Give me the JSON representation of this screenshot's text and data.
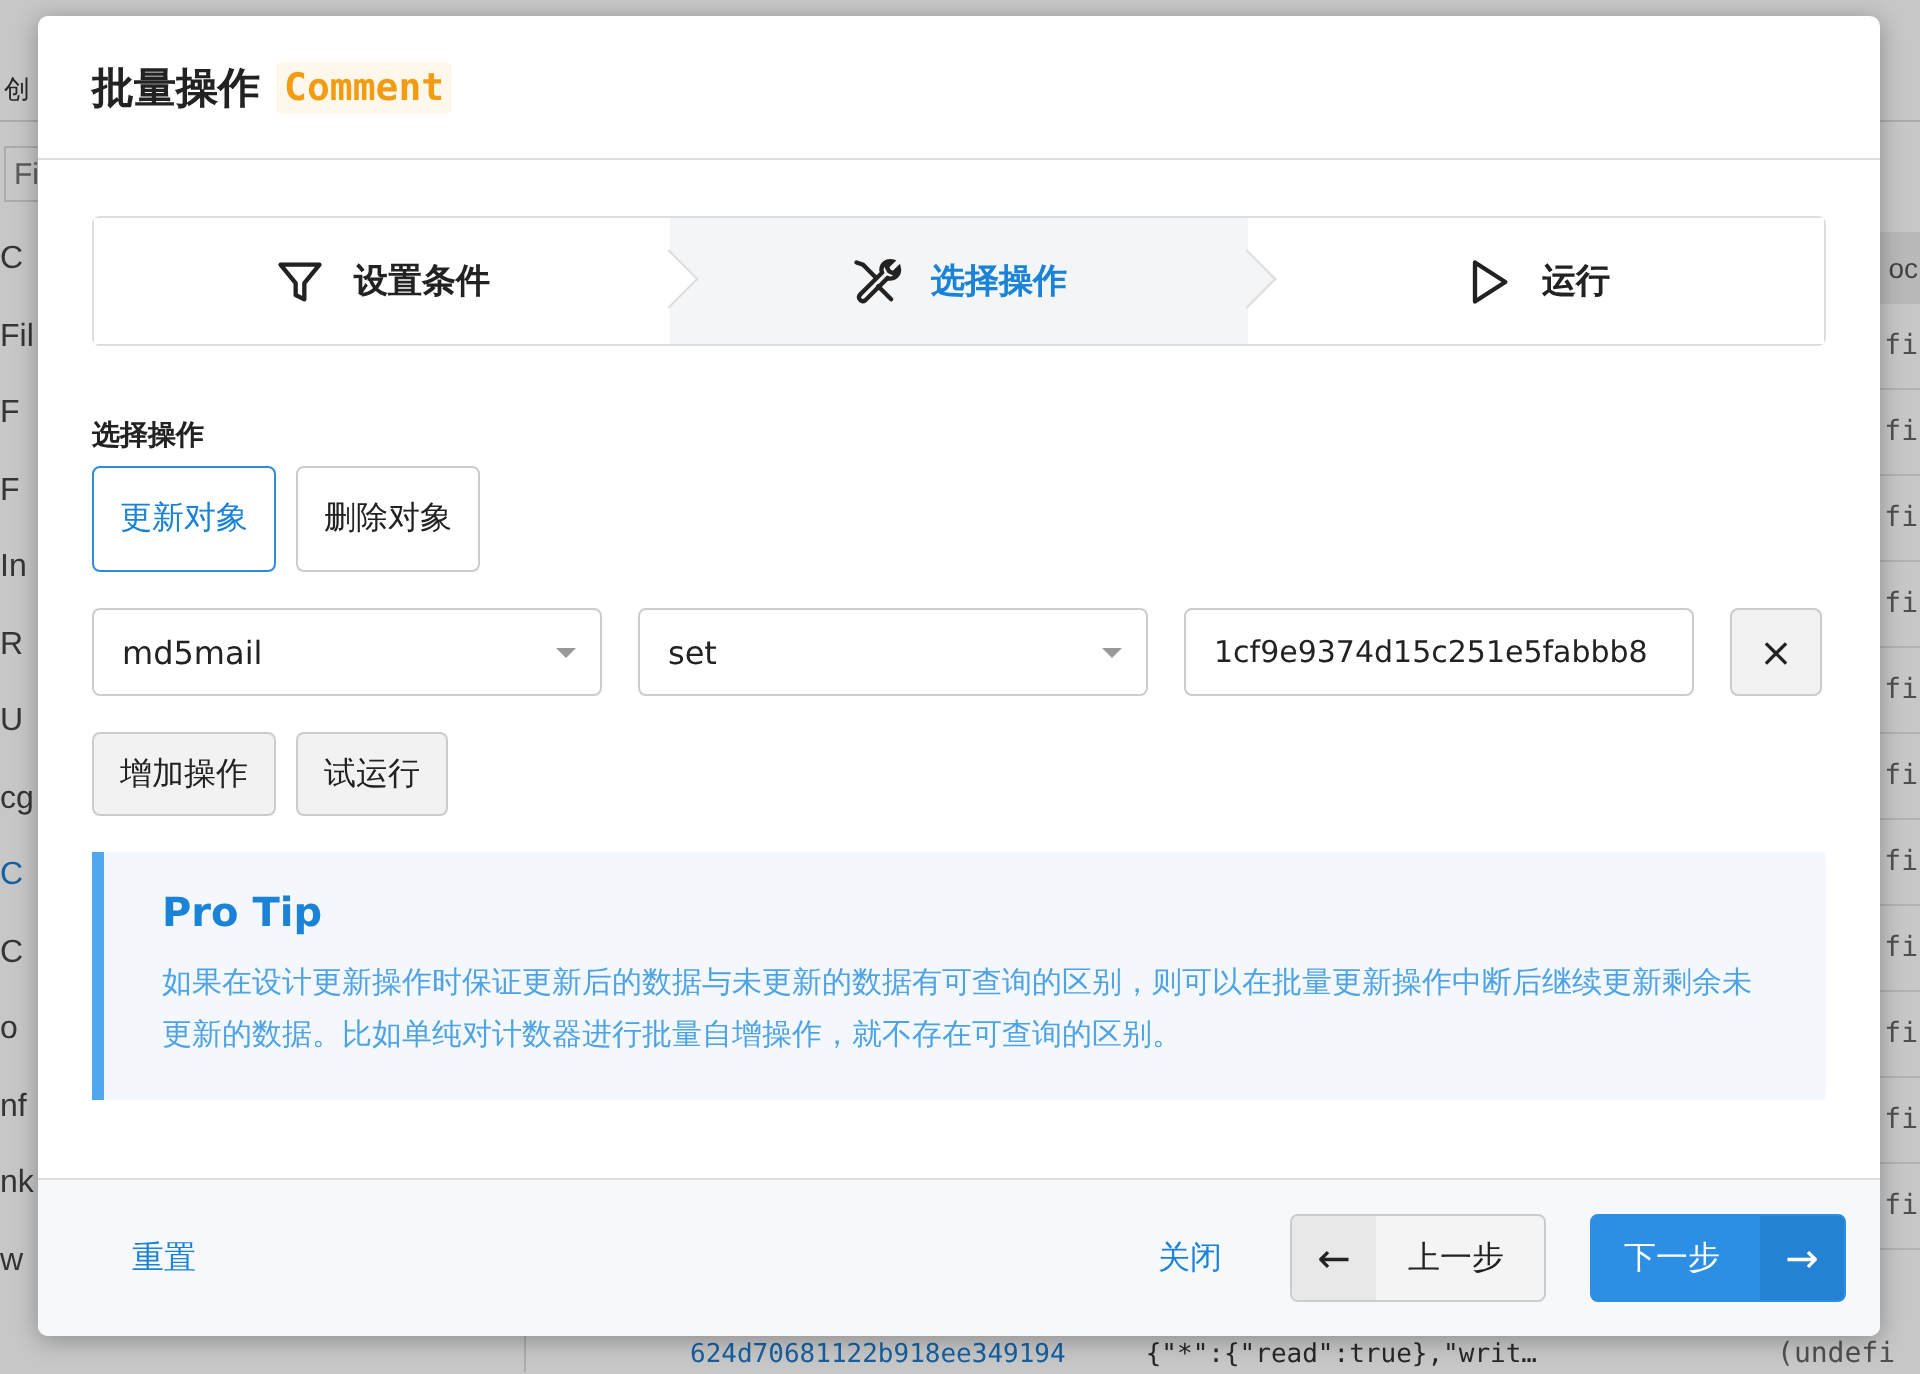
{
  "background": {
    "toolbar_button": "创",
    "filter_placeholder": "Fi",
    "sidebar_items": [
      {
        "label": "C",
        "selected": false
      },
      {
        "label": "Fil",
        "selected": false
      },
      {
        "label": "F",
        "selected": false
      },
      {
        "label": "F",
        "selected": false
      },
      {
        "label": "In",
        "selected": false
      },
      {
        "label": "R",
        "selected": false
      },
      {
        "label": "U",
        "selected": false
      },
      {
        "label": "cg",
        "selected": false
      },
      {
        "label": "C",
        "selected": true
      },
      {
        "label": "C",
        "selected": false
      },
      {
        "label": "o",
        "selected": false
      },
      {
        "label": "nf",
        "selected": false
      },
      {
        "label": "nk",
        "selected": false
      },
      {
        "label": "w",
        "selected": false
      }
    ],
    "table_header": "oc",
    "table_cells": [
      "fi",
      "fi",
      "fi",
      "fi",
      "fi",
      "fi",
      "fi",
      "fi",
      "fi",
      "fi",
      "fi"
    ],
    "last_row": {
      "id": "624d70681122b918ee349194",
      "acl": "{\"*\":{\"read\":true},\"writ…",
      "value": "(undefi"
    }
  },
  "dialog": {
    "title": "批量操作",
    "class_tag": "Comment",
    "steps": [
      {
        "label": "设置条件",
        "selected": false
      },
      {
        "label": "选择操作",
        "selected": true
      },
      {
        "label": "运行",
        "selected": false
      }
    ],
    "section_label": "选择操作",
    "operation_types": [
      {
        "label": "更新对象",
        "selected": true
      },
      {
        "label": "删除对象",
        "selected": false
      }
    ],
    "operation_row": {
      "field": "md5mail",
      "operator": "set",
      "value": "1cf9e9374d15c251e5fabbb8",
      "remove": "×"
    },
    "action_buttons": [
      "增加操作",
      "试运行"
    ],
    "tip": {
      "title": "Pro Tip",
      "text": "如果在设计更新操作时保证更新后的数据与未更新的数据有可查询的区别，则可以在批量更新操作中断后继续更新剩余未更新的数据。比如单纯对计数器进行批量自增操作，就不存在可查询的区别。"
    },
    "footer": {
      "reset": "重置",
      "close": "关闭",
      "prev": "上一步",
      "prev_arrow": "←",
      "next": "下一步",
      "next_arrow": "→"
    }
  }
}
